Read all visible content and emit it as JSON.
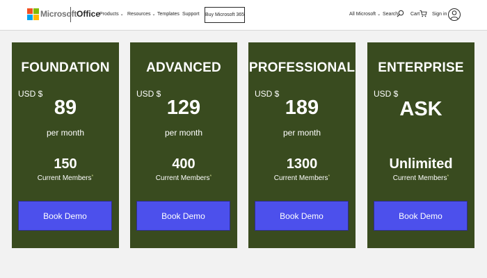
{
  "header": {
    "brand": "Microsoft",
    "product": "Office",
    "nav": [
      {
        "label": "Products",
        "dropdown": true
      },
      {
        "label": "Resources",
        "dropdown": true
      },
      {
        "label": "Templates",
        "dropdown": false
      },
      {
        "label": "Support",
        "dropdown": false
      }
    ],
    "buy_button": "Buy Microsoft 365",
    "all_microsoft": "All Microsoft",
    "search_label": "Search",
    "cart_label": "Cart",
    "signin_label": "Sign in",
    "icons": [
      "microsoft-logo-icon",
      "chevron-down-icon",
      "search-icon",
      "cart-icon",
      "avatar-icon"
    ],
    "colors": {
      "logo_red": "#f25022",
      "logo_green": "#7fba00",
      "logo_blue": "#00a4ef",
      "logo_yellow": "#ffb900"
    }
  },
  "plans": [
    {
      "name": "FOUNDATION",
      "currency": "USD $",
      "price": "89",
      "period": "per month",
      "members": "150",
      "members_label": "Current Members",
      "asterisk": "*",
      "button": "Book Demo"
    },
    {
      "name": "ADVANCED",
      "currency": "USD $",
      "price": "129",
      "period": "per month",
      "members": "400",
      "members_label": "Current Members",
      "asterisk": "*",
      "button": "Book Demo"
    },
    {
      "name": "PROFESSIONAL",
      "currency": "USD $",
      "price": "189",
      "period": "per month",
      "members": "1300",
      "members_label": "Current Members",
      "asterisk": "*",
      "button": "Book Demo"
    },
    {
      "name": "ENTERPRISE",
      "currency": "USD $",
      "price": "ASK",
      "period": "",
      "members": "Unlimited",
      "members_label": "Current Members",
      "asterisk": "*",
      "button": "Book Demo"
    }
  ],
  "colors": {
    "card_background": "#394b1f",
    "button_background": "#4c50ec",
    "page_background": "#f2f2f2"
  }
}
